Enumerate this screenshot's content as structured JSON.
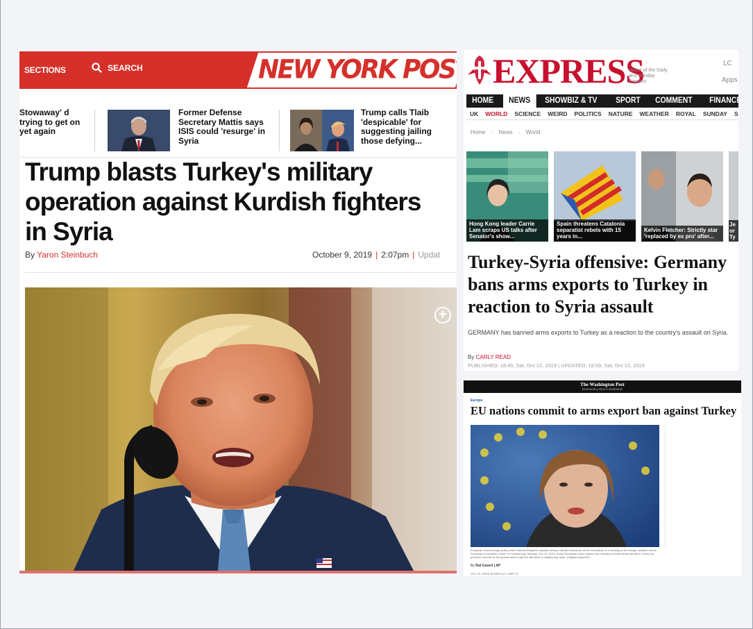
{
  "nypost": {
    "sections_label": "SECTIONS",
    "search_label": "SEARCH",
    "logo_text": "NEW YORK POST",
    "strip": [
      {
        "text": "Stowaway' d trying to get on yet again"
      },
      {
        "text": "Former Defense Secretary Mattis says ISIS could 'resurge' in Syria"
      },
      {
        "text": "Trump calls Tlaib 'despicable' for suggesting jailing those defying..."
      }
    ],
    "headline": "Trump blasts Turkey's military operation against Kurdish fighters in Syria",
    "byline_prefix": "By",
    "author": "Yaron Steinbuch",
    "date": "October 9, 2019",
    "time": "2:07pm",
    "updated_label": "Updat",
    "sep": "|",
    "expand_icon": "+"
  },
  "express": {
    "logo_text": "EXPRESS",
    "tagline": "Home of the Daily and Sunday Express",
    "login": "LC",
    "apps": "Apps",
    "nav": [
      "HOME",
      "NEWS",
      "SHOWBIZ & TV",
      "SPORT",
      "COMMENT",
      "FINANCE"
    ],
    "nav_active": "NEWS",
    "subnav": [
      "UK",
      "WORLD",
      "SCIENCE",
      "WEIRD",
      "POLITICS",
      "NATURE",
      "WEATHER",
      "ROYAL",
      "SUNDAY",
      "SC"
    ],
    "subnav_active": "WORLD",
    "breadcrumb": [
      "Home",
      "News",
      "World"
    ],
    "tiles": [
      {
        "caption": "Hong Kong leader Carrie Lam scraps US talks after Senator's show..."
      },
      {
        "caption": "Spain threatens Catalonia separatist rebels with 15 years in..."
      },
      {
        "caption": "Kelvin Fletcher: Strictly star 'replaced by ex pro' after..."
      },
      {
        "caption": "Je or Ty"
      }
    ],
    "headline": "Turkey-Syria offensive: Germany bans arms exports to Turkey in reaction to Syria assault",
    "standfirst": "GERMANY has banned arms exports to Turkey as a reaction to the country's assault on Syria.",
    "byline_prefix": "By",
    "author": "CARLY READ",
    "published": "PUBLISHED: 18:45, Sat, Oct 12, 2019 | UPDATED: 18:59, Sat, Oct 12, 2019"
  },
  "wapo": {
    "masthead": "The Washington Post",
    "masthead_sub": "Democracy Dies in Darkness",
    "kicker": "Europe",
    "headline": "EU nations commit to arms export ban against Turkey",
    "caption": "European Union foreign policy chief Federica Mogherini speaks during a media conference at the conclusion of a meeting of EU foreign ministers at the European Convention Center in Luxembourg, Monday, Oct. 14, 2019. Some European Union nations are moving to restrict arms exports to Turkey as pressure mounts on the government to halt the offensive in neighboring Syria. (Virginia Mayo/AP)",
    "credit_prefix": "By",
    "credit": "Raf Casert | AP",
    "date": "Oct. 14, 2019 at 9:02 a.m. GMT+3"
  }
}
